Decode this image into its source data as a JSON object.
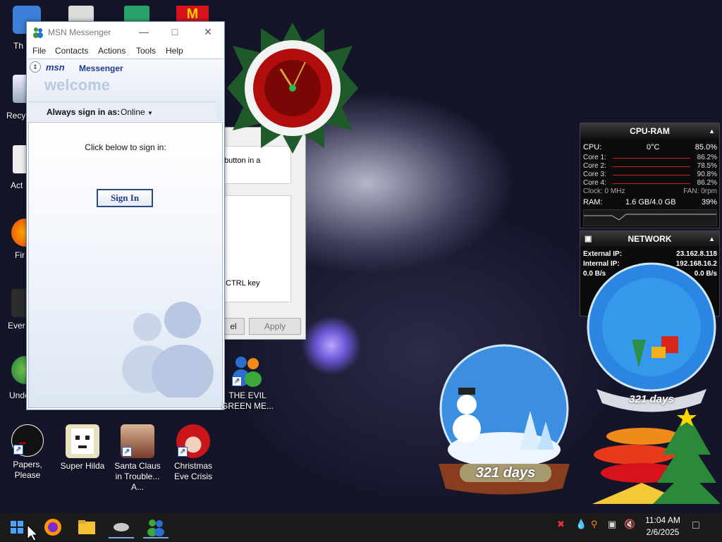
{
  "desktop": {
    "partial_labels": [
      "Th",
      "Recy",
      "Act",
      "Fir",
      "Ever",
      "Unde"
    ],
    "icons": [
      {
        "label": "Papers, Please"
      },
      {
        "label": "Super Hilda"
      },
      {
        "label": "Santa Claus in Trouble... A..."
      },
      {
        "label": "Christmas Eve Crisis"
      },
      {
        "label": "THE EVIL GREEN ME..."
      }
    ]
  },
  "bg_dialog": {
    "text1": "button in a",
    "text2": "CTRL key",
    "cancel": "el",
    "apply": "Apply"
  },
  "msn": {
    "title": "MSN Messenger",
    "menu": [
      "File",
      "Contacts",
      "Actions",
      "Tools",
      "Help"
    ],
    "logo_msn": "msn",
    "logo_messenger": "Messenger",
    "welcome": "welcome",
    "always_label": "Always sign in as:",
    "status": "Online",
    "click_below": "Click below to sign in:",
    "sign_in": "Sign In"
  },
  "cpu_ram": {
    "title": "CPU-RAM",
    "cpu_label": "CPU:",
    "cpu_temp": "0°C",
    "cpu_pct": "85.0%",
    "cores": [
      {
        "label": "Core 1:",
        "value": "86.2%"
      },
      {
        "label": "Core 2:",
        "value": "78.5%"
      },
      {
        "label": "Core 3:",
        "value": "90.8%"
      },
      {
        "label": "Core 4:",
        "value": "86.2%"
      }
    ],
    "clock": "Clock: 0 MHz",
    "fan": "FAN: 0rpm",
    "ram_label": "RAM:",
    "ram_used": "1.6 GB/4.0 GB",
    "ram_pct": "39%"
  },
  "network": {
    "title": "NETWORK",
    "external_label": "External IP:",
    "external_ip": "23.162.8.118",
    "internal_label": "Internal IP:",
    "internal_ip": "192.168.16.2",
    "down": "0.0 B/s",
    "up": "0.0 B/s"
  },
  "gadgets": {
    "globe_days_1": "321 days",
    "globe_days_2": "321 days"
  },
  "taskbar": {
    "time": "11:04 AM",
    "date": "2/6/2025"
  }
}
